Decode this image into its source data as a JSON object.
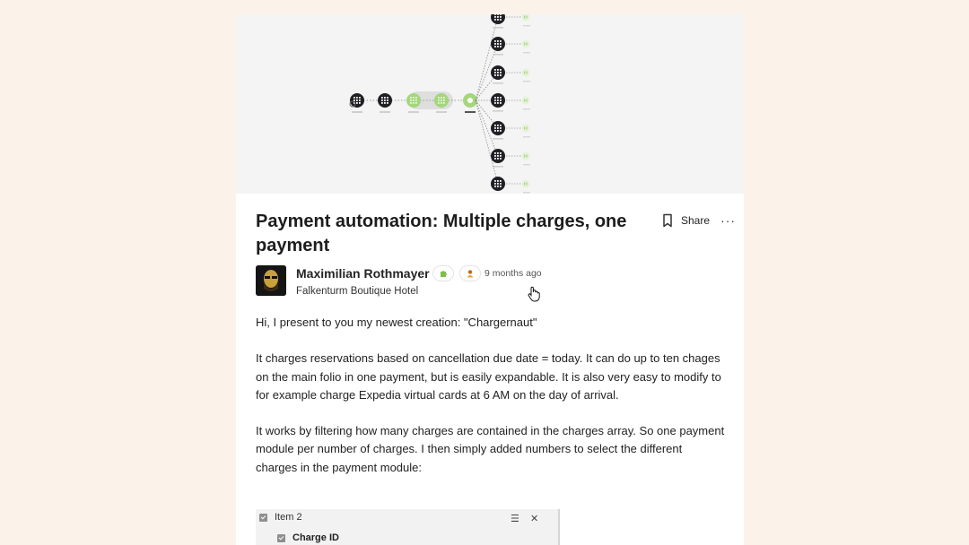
{
  "post": {
    "title": "Payment automation: Multiple charges, one payment",
    "actions": {
      "share_label": "Share"
    },
    "author": {
      "name": "Maximilian Rothmayer",
      "organization": "Falkenturm Boutique Hotel",
      "timestamp": "9 months ago",
      "badges": [
        "puzzle-badge-icon",
        "person-badge-icon"
      ]
    },
    "paragraphs": [
      "Hi, I present to you my newest creation: \"Chargernaut\"",
      "It charges reservations based on cancellation due date = today. It can do up to ten chages on the main folio in one payment, but is easily expandable. It is also very easy to modify to for example charge Expedia virtual cards at 6 AM on the day of arrival.",
      "It works by filtering how many charges are contained in the charges array. So one payment module per number of charges. I then simply added numbers to select the different charges in the payment module:"
    ],
    "embed": {
      "item_label": "Item 2",
      "field_label": "Charge ID"
    }
  },
  "colors": {
    "page_background": "#fbf3ea",
    "module_dark": "#1f1f24",
    "module_green": "#a4d67c"
  }
}
